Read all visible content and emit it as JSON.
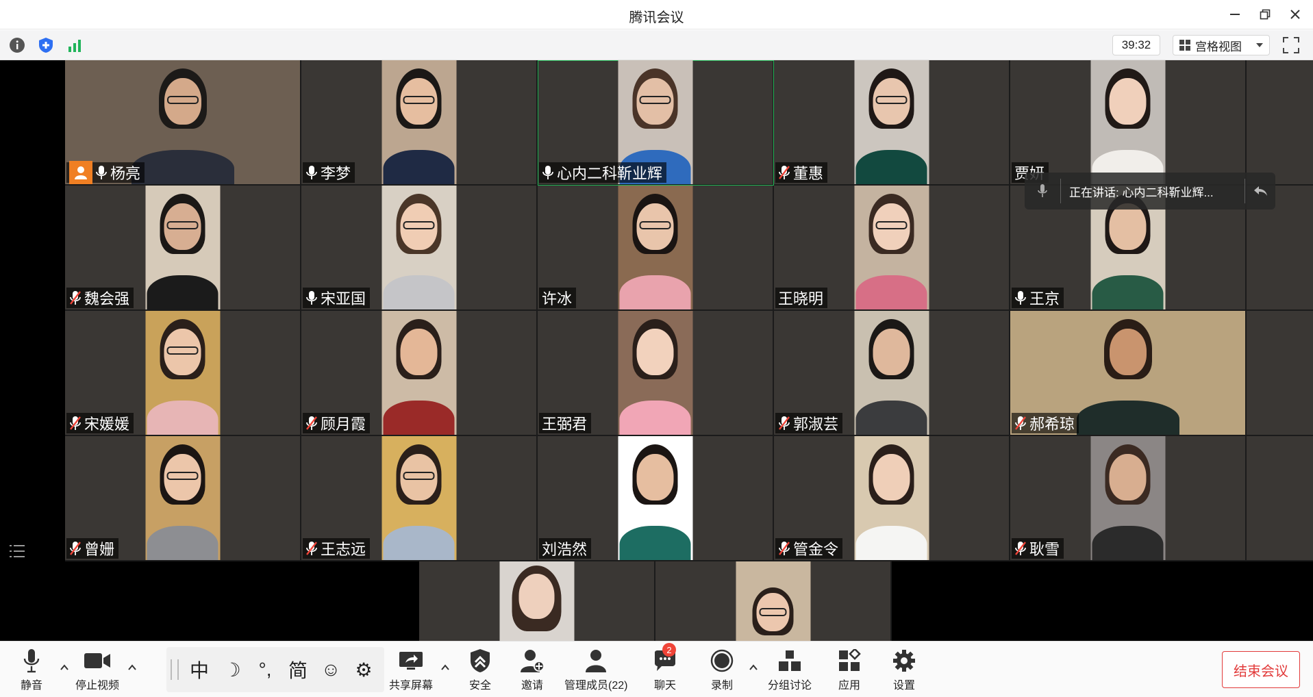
{
  "window": {
    "title": "腾讯会议"
  },
  "toolbar": {
    "timer": "39:32",
    "view_mode": "宫格视图"
  },
  "participants": [
    {
      "name": "杨亮",
      "mic": "on",
      "host": true
    },
    {
      "name": "李梦",
      "mic": "on"
    },
    {
      "name": "心内二科靳业辉",
      "mic": "on",
      "speaking": true
    },
    {
      "name": "董惠",
      "mic": "muted"
    },
    {
      "name": "贾妍",
      "mic": "none"
    },
    {
      "name": "",
      "mic": "none"
    },
    {
      "name": "魏会强",
      "mic": "muted"
    },
    {
      "name": "宋亚国",
      "mic": "on"
    },
    {
      "name": "许冰",
      "mic": "none"
    },
    {
      "name": "王晓明",
      "mic": "none"
    },
    {
      "name": "王京",
      "mic": "on"
    },
    {
      "name": "",
      "mic": "none"
    },
    {
      "name": "宋媛媛",
      "mic": "muted"
    },
    {
      "name": "顾月霞",
      "mic": "muted"
    },
    {
      "name": "王弼君",
      "mic": "none"
    },
    {
      "name": "郭淑芸",
      "mic": "muted"
    },
    {
      "name": "郝希琼",
      "mic": "muted"
    },
    {
      "name": "",
      "mic": "none"
    },
    {
      "name": "曾姗",
      "mic": "muted"
    },
    {
      "name": "王志远",
      "mic": "muted"
    },
    {
      "name": "刘浩然",
      "mic": "none"
    },
    {
      "name": "管金令",
      "mic": "muted"
    },
    {
      "name": "耿雪",
      "mic": "muted"
    },
    {
      "name": "",
      "mic": "none"
    }
  ],
  "speaking_toast": {
    "text": "正在讲话: 心内二科靳业辉..."
  },
  "bottom": {
    "mute": "静音",
    "stop_video": "停止视频",
    "ime": [
      "中",
      "☽",
      "°,",
      "简",
      "☺",
      "⚙"
    ],
    "share": "共享屏幕",
    "security": "安全",
    "invite": "邀请",
    "manage": "管理成员(22)",
    "chat": "聊天",
    "chat_badge": "2",
    "record": "录制",
    "breakout": "分组讨论",
    "apps": "应用",
    "settings": "设置",
    "end": "结束会议"
  },
  "colors": {
    "accent_orange": "#f07f23",
    "end_red": "#e23b3b",
    "speaking_green": "#20b454"
  }
}
